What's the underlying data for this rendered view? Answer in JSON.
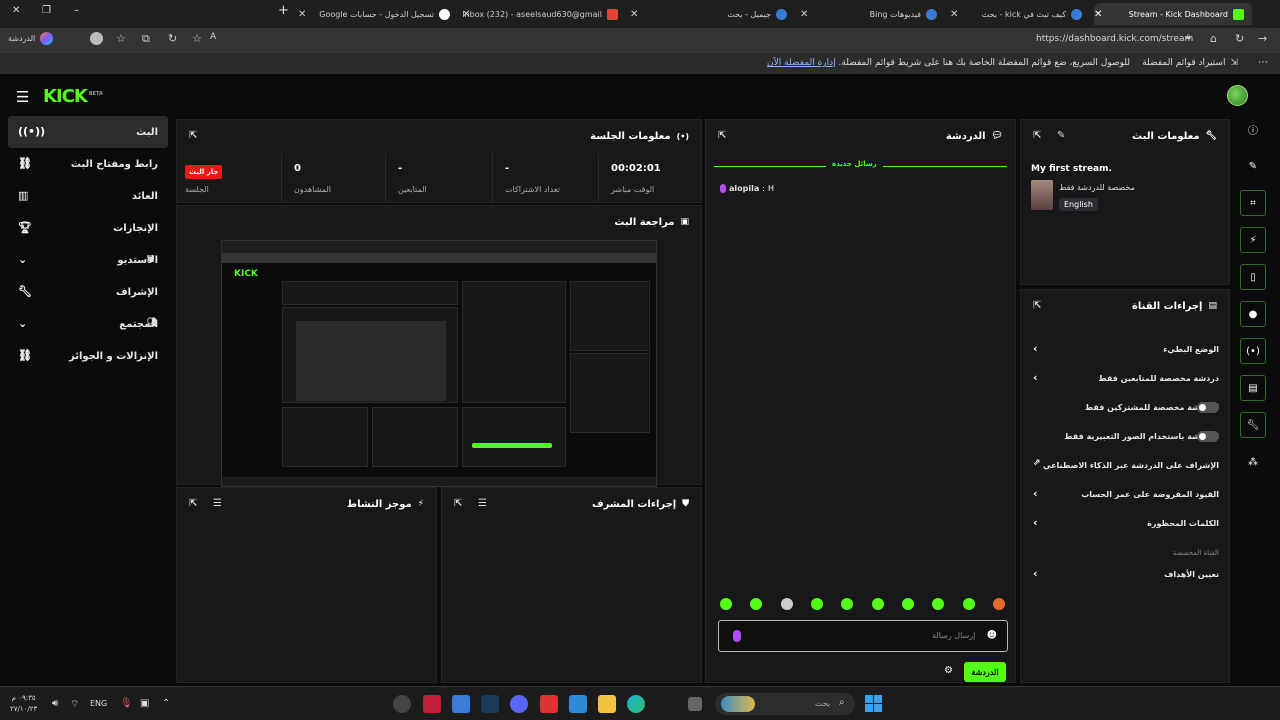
{
  "browser": {
    "tabs": [
      {
        "label": "Stream - Kick Dashboard",
        "active": true
      },
      {
        "label": "كيف تبث في kick - بحث"
      },
      {
        "label": "فيديوهات Bing"
      },
      {
        "label": "جيميل - بحث"
      },
      {
        "label": "Inbox (232) - aseelsaud630@gmail"
      },
      {
        "label": "تسجيل الدخول - حسابات Google"
      }
    ],
    "url": "https://dashboard.kick.com/stream",
    "profile_label": "الدردشة",
    "favorites_bar": {
      "import_label": "استيراد قوائم المفضلة",
      "message": "للوصول السريع، ضع قوائم المفضلة الخاصة بك هنا على شريط قوائم المفضلة.",
      "manage_link": "إدارة المفضلة الآن"
    }
  },
  "brand": {
    "logo": "KICK",
    "beta": "BETA",
    "accent": "#53fc18"
  },
  "sidebar": {
    "items": [
      {
        "label": "البث",
        "icon": "broadcast-icon"
      },
      {
        "label": "رابط ومفتاح البث",
        "icon": "link-icon"
      },
      {
        "label": "العائد",
        "icon": "chart-icon"
      },
      {
        "label": "الإنجازات",
        "icon": "trophy-icon"
      },
      {
        "label": "الاستديو",
        "icon": "studio-icon"
      },
      {
        "label": "الإشراف",
        "icon": "wrench-icon"
      },
      {
        "label": "المجتمع",
        "icon": "people-icon"
      },
      {
        "label": "الإنزالات و الجوائز",
        "icon": "drops-icon"
      }
    ]
  },
  "session": {
    "title": "معلومات الجلسة",
    "live_badge": "جار البث",
    "stats": [
      {
        "label": "الجلسة",
        "value": ""
      },
      {
        "label": "المشاهدون",
        "value": "0"
      },
      {
        "label": "المتابعين",
        "value": "-"
      },
      {
        "label": "تعداد الاشتراكات",
        "value": "-"
      },
      {
        "label": "الوقت مباشر",
        "value": "00:02:01"
      }
    ]
  },
  "preview": {
    "title": "مراجعة البث"
  },
  "activity": {
    "title": "موجز النشاط"
  },
  "mod_actions": {
    "title": "إجراءات المشرف"
  },
  "chat": {
    "title": "الدردشة",
    "new_messages": "رسائل جديدة",
    "message": {
      "user": "alopila",
      "text": "H"
    },
    "input_placeholder": "إرسال رسالة",
    "send_label": "الدردشة"
  },
  "stream_info": {
    "title": "معلومات البث",
    "stream_title": "My first stream.",
    "category": "مخصصة للدردشة فقط",
    "language": "English"
  },
  "channel_actions": {
    "title": "إجراءات القناة",
    "items": [
      {
        "label": "الوضع البطيء",
        "control": "chevron"
      },
      {
        "label": "دردشة مخصصة للمتابعين فقط",
        "control": "chevron"
      },
      {
        "label": "الدردشة مخصصة للمشتركين فقط",
        "control": "toggle"
      },
      {
        "label": "الدردشة باستخدام الصور التعبيرية فقط",
        "control": "toggle"
      },
      {
        "label": "الإشراف على الدردشة عبر الذكاء الاصطناعي",
        "control": "external"
      },
      {
        "label": "القيود المفروضة على عمر الحساب",
        "control": "chevron"
      },
      {
        "label": "الكلمات المحظورة",
        "control": "chevron"
      }
    ],
    "custom_label": "القناة المخصصة",
    "goals_label": "تعيين الأهداف"
  },
  "taskbar": {
    "time": "٠٩:٣٥ م",
    "date": "٢٧/١٠/٢٣",
    "lang": "ENG",
    "search_placeholder": "بحث"
  }
}
